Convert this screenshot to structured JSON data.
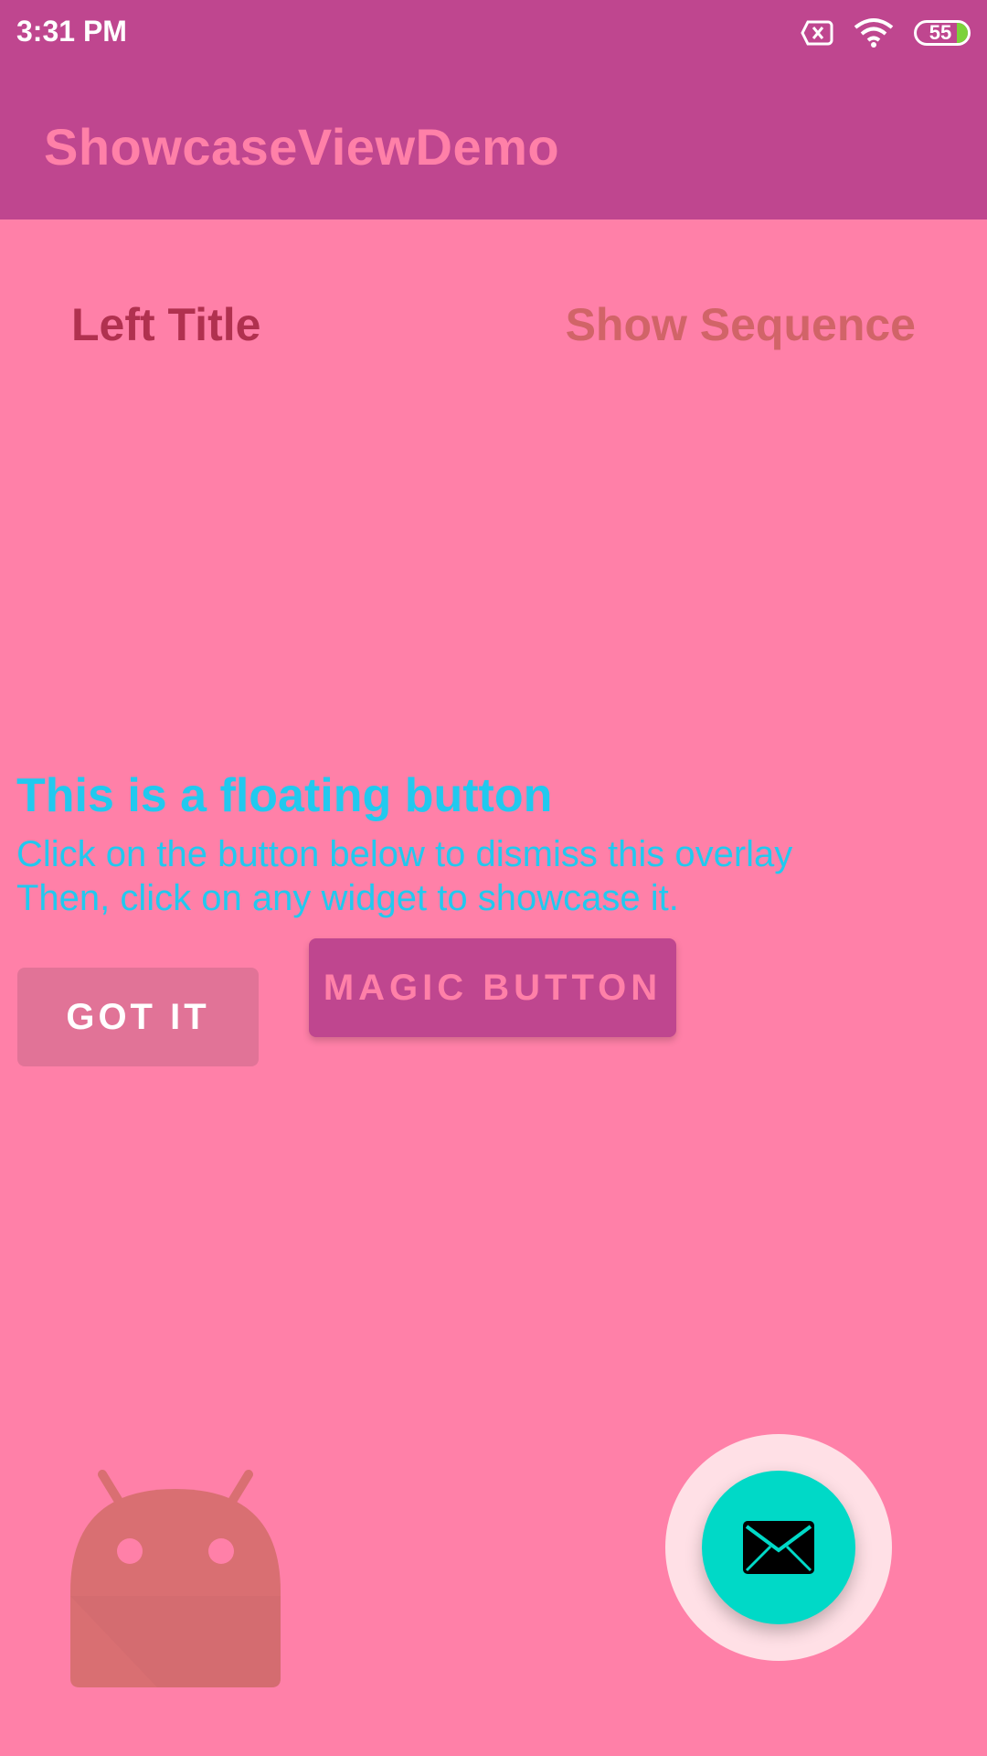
{
  "status_bar": {
    "time": "3:31 PM",
    "battery_level": "55",
    "icons": [
      "sim-off-icon",
      "wifi-icon",
      "battery-icon"
    ]
  },
  "app_bar": {
    "title": "ShowcaseViewDemo"
  },
  "header": {
    "left_title": "Left Title",
    "show_sequence": "Show Sequence"
  },
  "showcase": {
    "title": "This is a floating button",
    "line1": "Click on the button below to dismiss this overlay",
    "line2": "Then, click on any widget to showcase it.",
    "got_it_label": "GOT IT"
  },
  "main": {
    "magic_button_label": "MAGIC BUTTON",
    "fab_icon": "mail-icon",
    "logo_icon": "android-logo-icon"
  },
  "colors": {
    "overlay": "#ff80a8",
    "app_bar": "#bf468f",
    "showcase_text": "#21c9ef",
    "fab": "#00d9c7",
    "fab_halo": "#ffe0e6"
  }
}
